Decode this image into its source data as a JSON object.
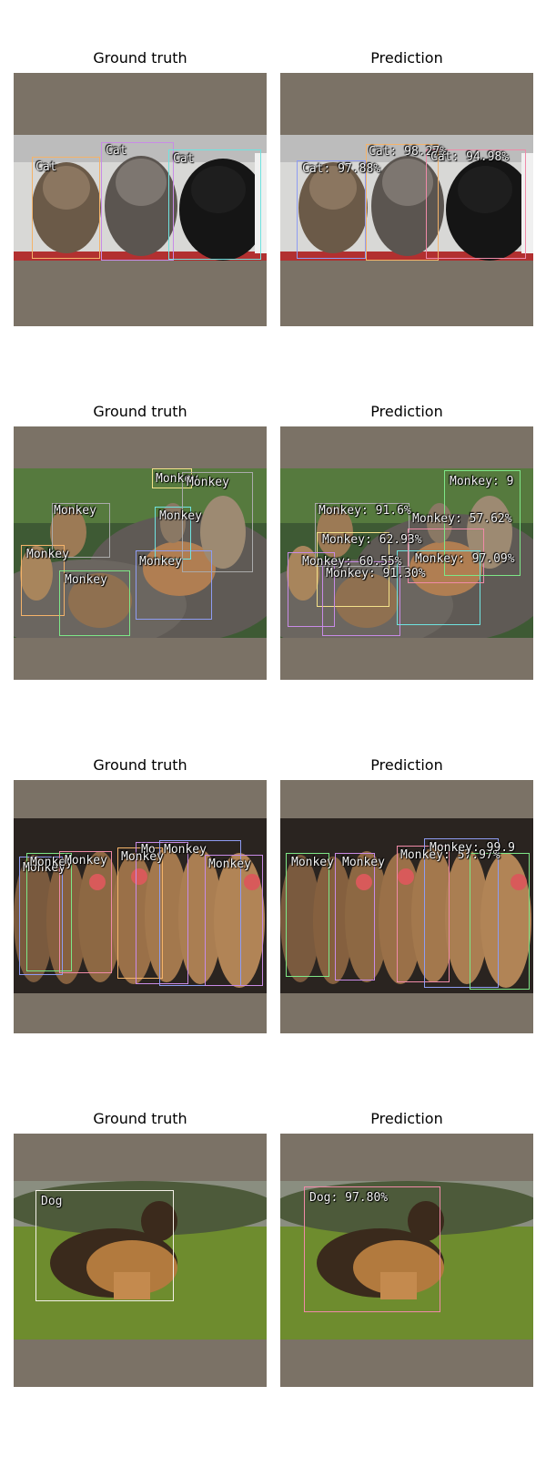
{
  "rows": [
    {
      "gt_title": "Ground truth",
      "pred_title": "Prediction",
      "gt_labels": [
        "Cat",
        "Cat",
        "Cat"
      ],
      "pred_labels": [
        "Cat: 97.88%",
        "Cat: 98.27%",
        "Cat: 94.98%"
      ]
    },
    {
      "gt_title": "Ground truth",
      "pred_title": "Prediction",
      "gt_labels": [
        "Monkey",
        "Monkey",
        "Monkey",
        "Monkey",
        "Monkey",
        "Monkey",
        "Monkey",
        "Monkey"
      ],
      "pred_labels": [
        "Monkey: 91.6%",
        "Monkey: 62.93%",
        "Monkey: 60.55%",
        "Monkey: 91.30%",
        "Monkey: 97.09%",
        "Monkey: 57.62%",
        "Monkey: 9"
      ]
    },
    {
      "gt_title": "Ground truth",
      "pred_title": "Prediction",
      "gt_labels": [
        "Monkey",
        "Monkey",
        "Monkey",
        "Mo",
        "Monkey",
        "Monkey",
        "Monkey"
      ],
      "pred_labels": [
        "Monkey",
        "Monkey",
        "Monkey: 57.97%",
        "Monkey: 99.9"
      ]
    },
    {
      "gt_title": "Ground truth",
      "pred_title": "Prediction",
      "gt_labels": [
        "Dog"
      ],
      "pred_labels": [
        "Dog: 97.80%"
      ]
    }
  ],
  "colors": {
    "background": "#7b7266",
    "box_orange": "#f4b36a",
    "box_purple": "#c88be6",
    "box_cyan": "#6fe3e0",
    "box_green": "#7ee787",
    "box_pink": "#f08aa8",
    "box_blue": "#8e9cf2",
    "box_white": "#f4f1e8"
  }
}
